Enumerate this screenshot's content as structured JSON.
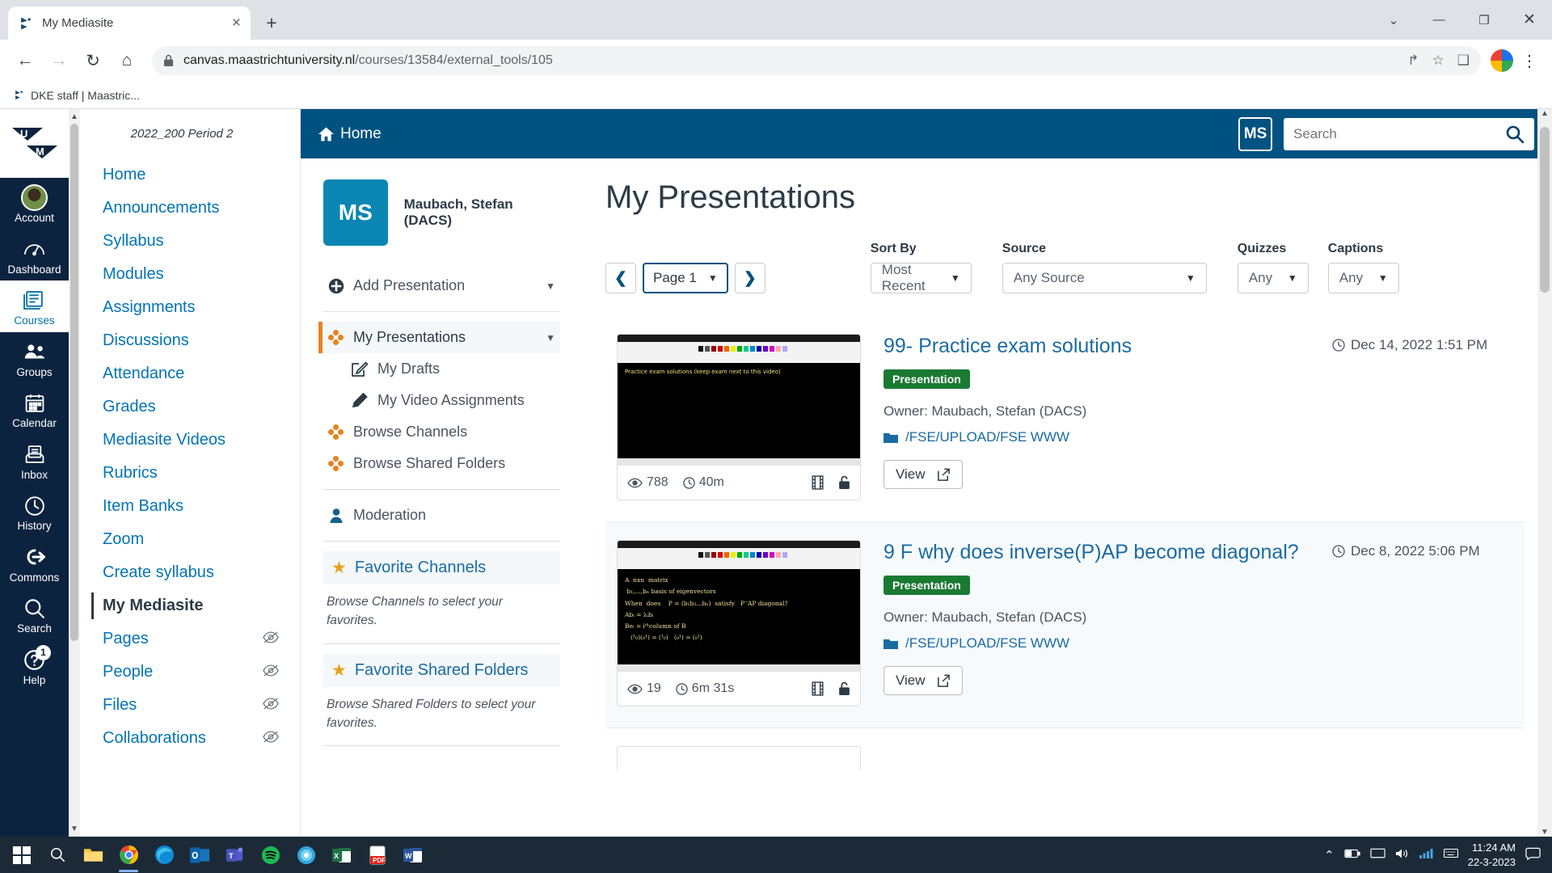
{
  "browser": {
    "tab": {
      "title": "My Mediasite",
      "favicon": "mediasite-icon",
      "close": "×"
    },
    "new_tab_label": "+",
    "window_controls": {
      "minimize_dropdown": "⌄",
      "minimize": "—",
      "maximize": "❐",
      "close": "✕"
    },
    "nav": {
      "back": "←",
      "forward": "→",
      "reload": "↻",
      "home": "⌂"
    },
    "omnibox": {
      "lock_icon": "lock-icon",
      "url_domain": "canvas.maastrichtuniversity.nl",
      "url_path": "/courses/13584/external_tools/105",
      "share_icon": "↱",
      "star_icon": "☆",
      "sidepanel_icon": "❑"
    },
    "menu_icon": "⋮",
    "bookmarks": [
      {
        "label": "DKE staff | Maastric...",
        "icon": "mediasite-icon"
      }
    ]
  },
  "canvas_global_nav": [
    {
      "name": "account",
      "label": "Account",
      "icon": "user-photo"
    },
    {
      "name": "dashboard",
      "label": "Dashboard",
      "icon": "dashboard-icon"
    },
    {
      "name": "courses",
      "label": "Courses",
      "icon": "courses-icon",
      "active": true
    },
    {
      "name": "groups",
      "label": "Groups",
      "icon": "groups-icon"
    },
    {
      "name": "calendar",
      "label": "Calendar",
      "icon": "calendar-icon"
    },
    {
      "name": "inbox",
      "label": "Inbox",
      "icon": "inbox-icon"
    },
    {
      "name": "history",
      "label": "History",
      "icon": "clock-icon"
    },
    {
      "name": "commons",
      "label": "Commons",
      "icon": "commons-icon"
    },
    {
      "name": "search",
      "label": "Search",
      "icon": "search-icon"
    },
    {
      "name": "help",
      "label": "Help",
      "icon": "help-icon",
      "badge": "1"
    }
  ],
  "course_nav": {
    "term": "2022_200 Period 2",
    "items": [
      {
        "label": "Home",
        "hidden": false
      },
      {
        "label": "Announcements",
        "hidden": false
      },
      {
        "label": "Syllabus",
        "hidden": false
      },
      {
        "label": "Modules",
        "hidden": false
      },
      {
        "label": "Assignments",
        "hidden": false
      },
      {
        "label": "Discussions",
        "hidden": false
      },
      {
        "label": "Attendance",
        "hidden": false
      },
      {
        "label": "Grades",
        "hidden": false
      },
      {
        "label": "Mediasite Videos",
        "hidden": false
      },
      {
        "label": "Rubrics",
        "hidden": false
      },
      {
        "label": "Item Banks",
        "hidden": false
      },
      {
        "label": "Zoom",
        "hidden": false
      },
      {
        "label": "Create syllabus",
        "hidden": false
      },
      {
        "label": "My Mediasite",
        "hidden": false,
        "active": true
      },
      {
        "label": "Pages",
        "hidden": true
      },
      {
        "label": "People",
        "hidden": true
      },
      {
        "label": "Files",
        "hidden": true
      },
      {
        "label": "Collaborations",
        "hidden": true
      }
    ]
  },
  "mediasite": {
    "topbar": {
      "home_label": "Home",
      "home_icon": "home-icon",
      "user_initials": "MS",
      "search_placeholder": "Search",
      "search_value": "",
      "search_icon": "search-icon"
    },
    "side": {
      "avatar_initials": "MS",
      "user_name": "Maubach, Stefan (DACS)",
      "add_presentation": "Add Presentation",
      "add_icon": "plus-circle-icon",
      "nav": [
        {
          "label": "My Presentations",
          "icon": "dots-icon",
          "selected": true,
          "caret": true
        },
        {
          "label": "My Drafts",
          "icon": "draft-edit-icon",
          "indent": true
        },
        {
          "label": "My Video Assignments",
          "icon": "pencil-icon",
          "indent": true
        },
        {
          "label": "Browse Channels",
          "icon": "dots-icon"
        },
        {
          "label": "Browse Shared Folders",
          "icon": "dots-icon"
        },
        {
          "label": "Moderation",
          "icon": "person-icon"
        }
      ],
      "favorite_channels": {
        "title": "Favorite Channels",
        "icon": "star-icon",
        "description": "Browse Channels to select your favorites."
      },
      "favorite_shared_folders": {
        "title": "Favorite Shared Folders",
        "icon": "star-icon",
        "description": "Browse Shared Folders to select your favorites."
      }
    },
    "main": {
      "title": "My Presentations",
      "pager": {
        "prev_icon": "chevron-left-icon",
        "next_icon": "chevron-right-icon",
        "page_label": "Page 1",
        "caret": "⌄"
      },
      "filters": [
        {
          "label": "Sort By",
          "value": "Most Recent",
          "name": "sort-by"
        },
        {
          "label": "Source",
          "value": "Any Source",
          "name": "source"
        },
        {
          "label": "Quizzes",
          "value": "Any",
          "name": "quizzes"
        },
        {
          "label": "Captions",
          "value": "Any",
          "name": "captions"
        }
      ],
      "presentations": [
        {
          "title": "99- Practice exam solutions",
          "badge": "Presentation",
          "owner": "Owner: Maubach, Stefan (DACS)",
          "path": "/FSE/UPLOAD/FSE WWW",
          "view_label": "View",
          "date": "Dec 14, 2022 1:51 PM",
          "views": "788",
          "duration": "40m",
          "thumb_text": "Practice exam solutions (keep exam next to this video)",
          "thumb_type": "blank-black",
          "video_icon": "film-icon",
          "lock_icon": "lock-open-icon"
        },
        {
          "title": "9 F why does inverse(P)AP become diagonal?",
          "badge": "Presentation",
          "owner": "Owner: Maubach, Stefan (DACS)",
          "path": "/FSE/UPLOAD/FSE WWW",
          "view_label": "View",
          "date": "Dec 8, 2022 5:06 PM",
          "views": "19",
          "duration": "6m 31s",
          "thumb_text": "A  nxn  matrix\n b₁,...,bₙ basis of eigenvectors\nWhen  does    P = (b₁b₂...bₙ)  satisfy   P⁻AP diagonal?\nAbᵢ = λᵢbᵢ\nBeᵢ = iᵗʰcolumn of B\n   (¹₀)(₀¹) = (¹₀)   (₀¹) = (₀¹)",
          "thumb_type": "handwriting",
          "video_icon": "film-icon",
          "lock_icon": "lock-open-icon"
        }
      ]
    }
  },
  "taskbar": {
    "start_icon": "windows-icon",
    "search_icon": "search-icon",
    "apps": [
      {
        "name": "file-explorer",
        "icon": "folder-icon",
        "color": "#f5b942"
      },
      {
        "name": "google-chrome",
        "icon": "chrome-icon",
        "active": true
      },
      {
        "name": "microsoft-edge",
        "icon": "edge-icon"
      },
      {
        "name": "outlook",
        "icon": "outlook-icon"
      },
      {
        "name": "microsoft-teams",
        "icon": "teams-icon"
      },
      {
        "name": "spotify",
        "icon": "spotify-icon"
      },
      {
        "name": "firefox-or-photos",
        "icon": "circle-icon"
      },
      {
        "name": "excel",
        "icon": "excel-icon"
      },
      {
        "name": "adobe-acrobat",
        "icon": "acrobat-icon"
      },
      {
        "name": "word",
        "icon": "word-icon"
      }
    ],
    "tray": {
      "chevron": "⌃",
      "battery_icon": "battery-icon",
      "display_icon": "monitor-icon",
      "volume_icon": "speaker-icon",
      "network_icon": "network-icon",
      "keyboard_icon": "keyboard-icon",
      "time": "11:24 AM",
      "date": "22-3-2023",
      "notifications_icon": "notification-icon"
    }
  },
  "colors": {
    "canvas_navy": "#0c2340",
    "canvas_link": "#0374B5",
    "mediasite_blue": "#005280",
    "accent_orange": "#e8821e",
    "badge_green": "#1a7a32"
  }
}
